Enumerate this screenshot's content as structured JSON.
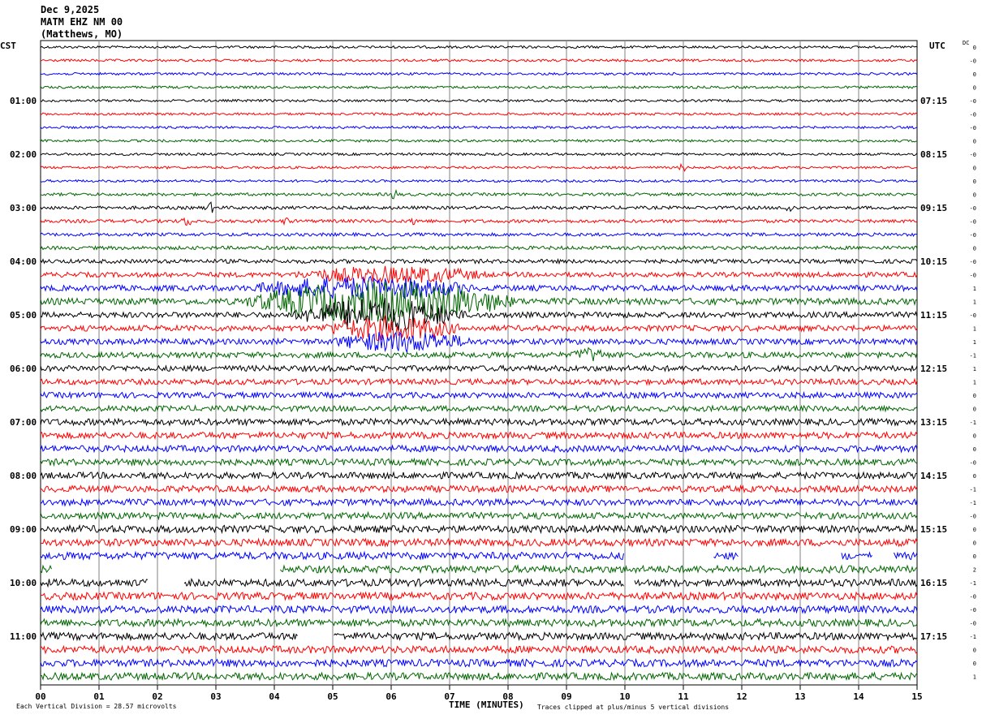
{
  "header": {
    "date": "Dec 9,2025",
    "station": "MATM EHZ NM 00",
    "location": "(Matthews, MO)"
  },
  "left_tz": "CST",
  "right_tz": "UTC",
  "dc_header": "DC",
  "footer": {
    "left": "Each Vertical Division =   28.57 microvolts",
    "center": "TIME (MINUTES)",
    "right": "Traces clipped at plus/minus 5 vertical divisions"
  },
  "colors": {
    "trace_cycle": [
      "#000000",
      "#ff0000",
      "#0000ff",
      "#006600"
    ],
    "grid": "#808080"
  },
  "chart_data": {
    "type": "line",
    "title": "",
    "xlabel": "TIME (MINUTES)",
    "x_range": [
      0,
      15
    ],
    "x_ticks": [
      "00",
      "01",
      "02",
      "03",
      "04",
      "05",
      "06",
      "07",
      "08",
      "09",
      "10",
      "11",
      "12",
      "13",
      "14",
      "15"
    ],
    "rows": 48,
    "row_minutes": 15,
    "left_time_labels": [
      {
        "row": 4,
        "label": "01:00"
      },
      {
        "row": 8,
        "label": "02:00"
      },
      {
        "row": 12,
        "label": "03:00"
      },
      {
        "row": 16,
        "label": "04:00"
      },
      {
        "row": 20,
        "label": "05:00"
      },
      {
        "row": 24,
        "label": "06:00"
      },
      {
        "row": 28,
        "label": "07:00"
      },
      {
        "row": 32,
        "label": "08:00"
      },
      {
        "row": 36,
        "label": "09:00"
      },
      {
        "row": 40,
        "label": "10:00"
      },
      {
        "row": 44,
        "label": "11:00"
      }
    ],
    "right_time_labels": [
      {
        "row": 4,
        "label": "07:15"
      },
      {
        "row": 8,
        "label": "08:15"
      },
      {
        "row": 12,
        "label": "09:15"
      },
      {
        "row": 16,
        "label": "10:15"
      },
      {
        "row": 20,
        "label": "11:15"
      },
      {
        "row": 24,
        "label": "12:15"
      },
      {
        "row": 28,
        "label": "13:15"
      },
      {
        "row": 32,
        "label": "14:15"
      },
      {
        "row": 36,
        "label": "15:15"
      },
      {
        "row": 40,
        "label": "16:15"
      },
      {
        "row": 44,
        "label": "17:15"
      }
    ],
    "dc_offsets": [
      "0",
      "-0",
      "0",
      "0",
      "-0",
      "-0",
      "-0",
      "0",
      "-0",
      "0",
      "0",
      "0",
      "-0",
      "-0",
      "-0",
      "0",
      "-0",
      "-0",
      "1",
      "1",
      "-0",
      "1",
      "1",
      "-1",
      "1",
      "1",
      "0",
      "0",
      "-1",
      "0",
      "0",
      "-0",
      "0",
      "-1",
      "-1",
      "-0",
      "0",
      "0",
      "0",
      "2",
      "-1",
      "-0",
      "-0",
      "-0",
      "-1",
      "0",
      "0",
      "1"
    ],
    "base_amplitude": [
      1.5,
      1.5,
      1.5,
      1.5,
      1.5,
      1.5,
      1.5,
      1.5,
      1.5,
      1.5,
      1.5,
      1.8,
      2,
      2,
      2,
      2.2,
      2.5,
      3,
      3.5,
      4,
      3.5,
      3.5,
      3.5,
      3.5,
      3.5,
      3.5,
      3.5,
      3.5,
      4,
      4,
      4,
      4,
      4,
      4,
      4,
      4,
      4.5,
      4.5,
      4.5,
      4.5,
      4.5,
      4.5,
      4.5,
      4.5,
      4.5,
      4.5,
      4.5,
      4.5
    ],
    "events": [
      {
        "row": 9,
        "minute": 11.0,
        "width_min": 0.15,
        "amp": 4
      },
      {
        "row": 11,
        "minute": 6.05,
        "width_min": 0.12,
        "amp": 7
      },
      {
        "row": 12,
        "minute": 2.9,
        "width_min": 0.2,
        "amp": 5
      },
      {
        "row": 12,
        "minute": 12.8,
        "width_min": 0.2,
        "amp": 5
      },
      {
        "row": 13,
        "minute": 2.5,
        "width_min": 0.2,
        "amp": 5
      },
      {
        "row": 13,
        "minute": 4.2,
        "width_min": 0.1,
        "amp": 5
      },
      {
        "row": 13,
        "minute": 6.4,
        "width_min": 0.15,
        "amp": 5
      },
      {
        "row": 17,
        "minute": 6.0,
        "width_min": 3.5,
        "amp": 8
      },
      {
        "row": 18,
        "minute": 5.5,
        "width_min": 4.0,
        "amp": 11
      },
      {
        "row": 19,
        "minute": 5.8,
        "width_min": 4.8,
        "amp": 22
      },
      {
        "row": 20,
        "minute": 5.8,
        "width_min": 3.0,
        "amp": 18
      },
      {
        "row": 21,
        "minute": 6.0,
        "width_min": 2.5,
        "amp": 12
      },
      {
        "row": 22,
        "minute": 6.2,
        "width_min": 2.5,
        "amp": 10
      },
      {
        "row": 23,
        "minute": 9.4,
        "width_min": 0.6,
        "amp": 6
      }
    ],
    "gaps": [
      {
        "row": 38,
        "from": 10.0,
        "to": 11.5
      },
      {
        "row": 38,
        "from": 11.95,
        "to": 13.7
      },
      {
        "row": 38,
        "from": 14.25,
        "to": 14.6
      },
      {
        "row": 39,
        "from": 0.2,
        "to": 4.1
      },
      {
        "row": 40,
        "from": 1.85,
        "to": 2.45
      },
      {
        "row": 40,
        "from": 10.0,
        "to": 10.15
      },
      {
        "row": 44,
        "from": 4.4,
        "to": 5.0
      }
    ]
  }
}
